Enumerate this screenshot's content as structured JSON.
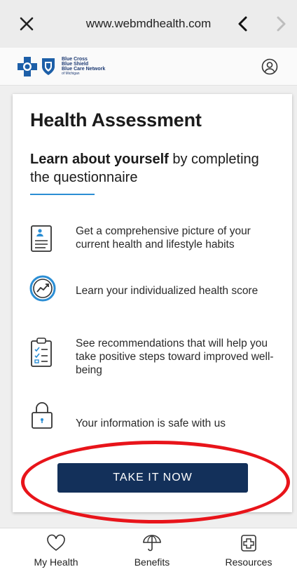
{
  "browser": {
    "url": "www.webmdhealth.com",
    "close_icon": "close-icon",
    "back_icon": "chevron-left-icon",
    "forward_icon": "chevron-right-icon"
  },
  "header": {
    "logo_lines": [
      "Blue Cross",
      "Blue Shield",
      "Blue Care Network",
      "of Michigan"
    ],
    "account_icon": "user-icon"
  },
  "card": {
    "title": "Health Assessment",
    "subtitle_bold": "Learn about yourself",
    "subtitle_rest": " by completing the questionnaire",
    "features": [
      {
        "icon": "document-icon",
        "text": "Get a comprehensive picture of your current health and lifestyle habits"
      },
      {
        "icon": "score-gauge-icon",
        "text": "Learn your individualized health score"
      },
      {
        "icon": "clipboard-checklist-icon",
        "text": "See recommendations that will help you take positive steps toward improved well-being"
      },
      {
        "icon": "lock-icon",
        "text": "Your information is safe with us"
      }
    ],
    "cta_label": "TAKE IT NOW"
  },
  "bottom_nav": [
    {
      "label": "My Health",
      "icon": "heart-icon"
    },
    {
      "label": "Benefits",
      "icon": "umbrella-icon"
    },
    {
      "label": "Resources",
      "icon": "plus-box-icon"
    }
  ],
  "colors": {
    "accent": "#2b8ed4",
    "cta": "#13305a",
    "highlight": "#e8141a",
    "brand": "#1d3a73"
  }
}
